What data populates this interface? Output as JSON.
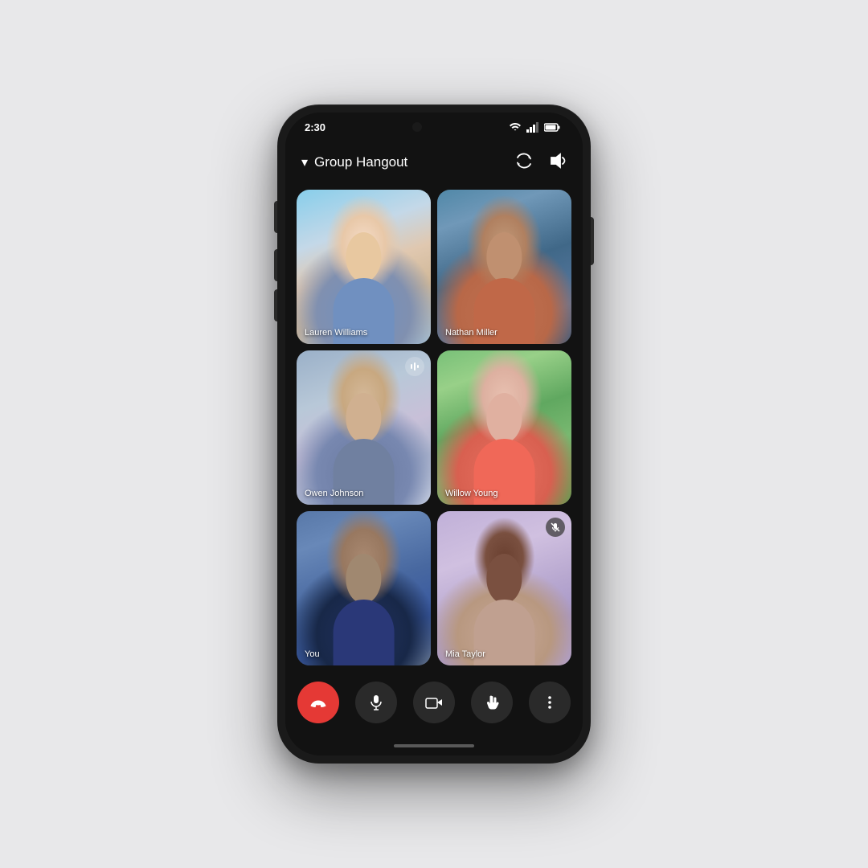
{
  "phone": {
    "status_bar": {
      "time": "2:30",
      "camera_label": "front camera notch"
    },
    "call_header": {
      "chevron": "▾",
      "title": "Group Hangout",
      "flip_camera_icon": "flip-camera",
      "speaker_icon": "speaker"
    },
    "video_grid": {
      "tiles": [
        {
          "id": "lauren",
          "name": "Lauren Williams",
          "class": "tile-lauren",
          "badge": null,
          "position": 1
        },
        {
          "id": "nathan",
          "name": "Nathan Miller",
          "class": "tile-nathan",
          "badge": null,
          "position": 2
        },
        {
          "id": "owen",
          "name": "Owen Johnson",
          "class": "tile-owen",
          "badge": "speaking",
          "position": 3
        },
        {
          "id": "willow",
          "name": "Willow Young",
          "class": "tile-willow",
          "badge": null,
          "position": 4
        },
        {
          "id": "you",
          "name": "You",
          "class": "tile-you",
          "badge": null,
          "position": 5
        },
        {
          "id": "mia",
          "name": "Mia Taylor",
          "class": "tile-mia",
          "badge": "muted",
          "position": 6
        }
      ]
    },
    "controls": {
      "end_call_label": "end call",
      "mute_label": "mute",
      "camera_label": "camera",
      "raise_hand_label": "raise hand",
      "more_label": "more options"
    }
  }
}
